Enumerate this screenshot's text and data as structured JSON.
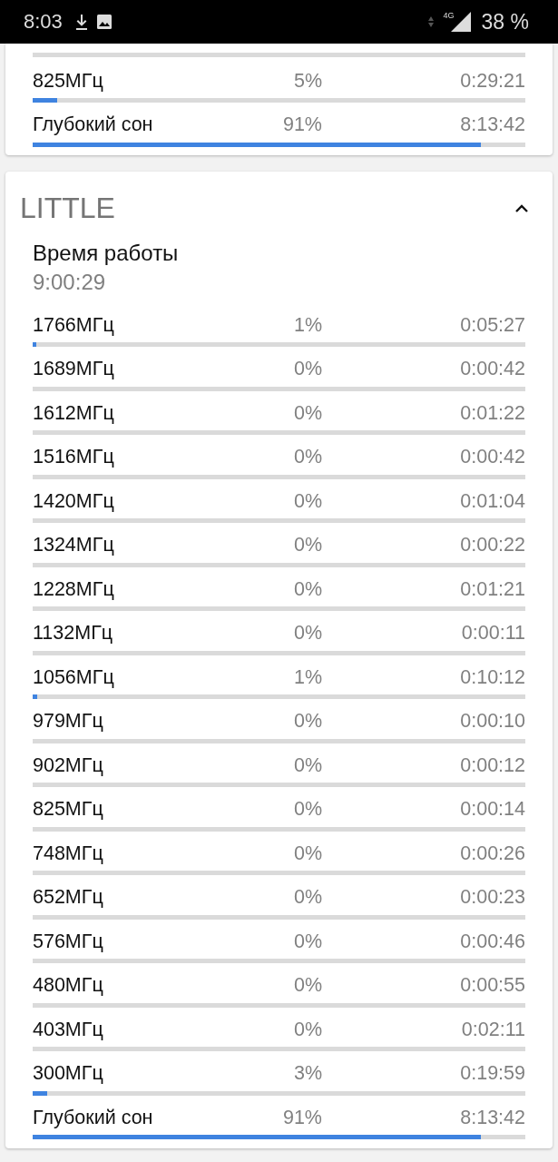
{
  "status_bar": {
    "time": "8:03",
    "network": "4G",
    "battery": "38 %"
  },
  "cards": [
    {
      "rows": [
        {
          "kind": "bar",
          "level": 0
        },
        {
          "kind": "row",
          "label": "825МГц",
          "percent": "5%",
          "time": "0:29:21",
          "level": 0.05
        },
        {
          "kind": "row",
          "label": "Глубокий сон",
          "percent": "91%",
          "time": "8:13:42",
          "level": 0.91
        }
      ]
    },
    {
      "title": "LITTLE",
      "expanded": true,
      "uptime_label": "Время работы",
      "uptime": "9:00:29",
      "rows": [
        {
          "kind": "row",
          "label": "1766МГц",
          "percent": "1%",
          "time": "0:05:27",
          "level": 0.008
        },
        {
          "kind": "row",
          "label": "1689МГц",
          "percent": "0%",
          "time": "0:00:42",
          "level": 0
        },
        {
          "kind": "row",
          "label": "1612МГц",
          "percent": "0%",
          "time": "0:01:22",
          "level": 0
        },
        {
          "kind": "row",
          "label": "1516МГц",
          "percent": "0%",
          "time": "0:00:42",
          "level": 0
        },
        {
          "kind": "row",
          "label": "1420МГц",
          "percent": "0%",
          "time": "0:01:04",
          "level": 0
        },
        {
          "kind": "row",
          "label": "1324МГц",
          "percent": "0%",
          "time": "0:00:22",
          "level": 0
        },
        {
          "kind": "row",
          "label": "1228МГц",
          "percent": "0%",
          "time": "0:01:21",
          "level": 0
        },
        {
          "kind": "row",
          "label": "1132МГц",
          "percent": "0%",
          "time": "0:00:11",
          "level": 0
        },
        {
          "kind": "row",
          "label": "1056МГц",
          "percent": "1%",
          "time": "0:10:12",
          "level": 0.01
        },
        {
          "kind": "row",
          "label": "979МГц",
          "percent": "0%",
          "time": "0:00:10",
          "level": 0
        },
        {
          "kind": "row",
          "label": "902МГц",
          "percent": "0%",
          "time": "0:00:12",
          "level": 0
        },
        {
          "kind": "row",
          "label": "825МГц",
          "percent": "0%",
          "time": "0:00:14",
          "level": 0
        },
        {
          "kind": "row",
          "label": "748МГц",
          "percent": "0%",
          "time": "0:00:26",
          "level": 0
        },
        {
          "kind": "row",
          "label": "652МГц",
          "percent": "0%",
          "time": "0:00:23",
          "level": 0
        },
        {
          "kind": "row",
          "label": "576МГц",
          "percent": "0%",
          "time": "0:00:46",
          "level": 0
        },
        {
          "kind": "row",
          "label": "480МГц",
          "percent": "0%",
          "time": "0:00:55",
          "level": 0
        },
        {
          "kind": "row",
          "label": "403МГц",
          "percent": "0%",
          "time": "0:02:11",
          "level": 0
        },
        {
          "kind": "row",
          "label": "300МГц",
          "percent": "3%",
          "time": "0:19:59",
          "level": 0.03
        },
        {
          "kind": "row",
          "label": "Глубокий сон",
          "percent": "91%",
          "time": "8:13:42",
          "level": 0.91
        }
      ]
    }
  ]
}
